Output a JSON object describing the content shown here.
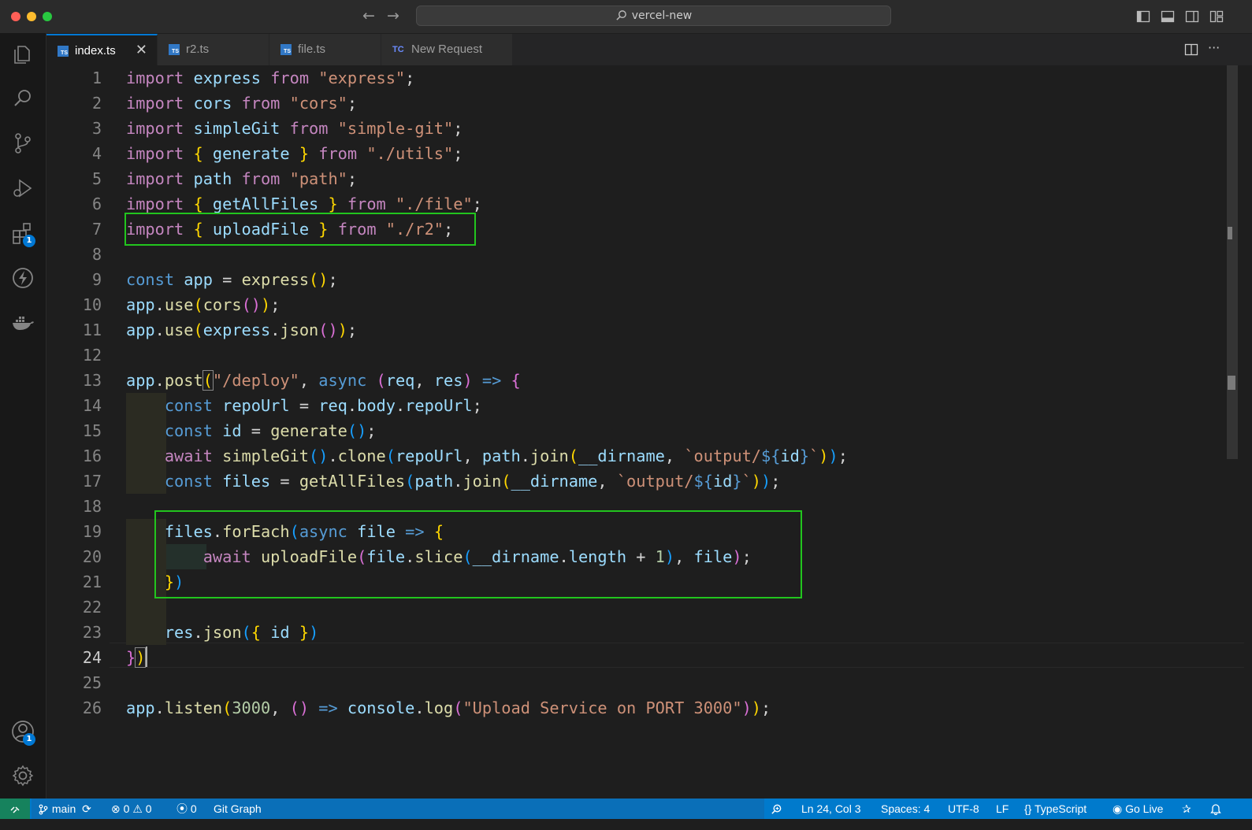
{
  "window": {
    "search_text": "vercel-new"
  },
  "tabs": [
    {
      "label": "index.ts",
      "icon": "ts-file-icon",
      "active": true
    },
    {
      "label": "r2.ts",
      "icon": "ts-file-icon"
    },
    {
      "label": "file.ts",
      "icon": "ts-file-icon"
    },
    {
      "label": "New Request",
      "icon": "tc",
      "icon_text": "TC"
    }
  ],
  "activity_bar": {
    "items": [
      "explorer-icon",
      "search-icon",
      "source-control-icon",
      "run-debug-icon",
      "extensions-icon",
      "thunder-client-icon",
      "docker-icon"
    ],
    "extensions_badge": "1",
    "accounts_badge": "1",
    "bottom_items": [
      "accounts-icon",
      "settings-gear-icon"
    ]
  },
  "editor": {
    "line_numbers": [
      "1",
      "2",
      "3",
      "4",
      "5",
      "6",
      "7",
      "8",
      "9",
      "10",
      "11",
      "12",
      "13",
      "14",
      "15",
      "16",
      "17",
      "18",
      "19",
      "20",
      "21",
      "22",
      "23",
      "24",
      "25",
      "26"
    ],
    "current_line": "24",
    "lines": [
      "import express from \"express\";",
      "import cors from \"cors\";",
      "import simpleGit from \"simple-git\";",
      "import { generate } from \"./utils\";",
      "import path from \"path\";",
      "import { getAllFiles } from \"./file\";",
      "import { uploadFile } from \"./r2\";",
      "",
      "const app = express();",
      "app.use(cors());",
      "app.use(express.json());",
      "",
      "app.post(\"/deploy\", async (req, res) => {",
      "    const repoUrl = req.body.repoUrl;",
      "    const id = generate();",
      "    await simpleGit().clone(repoUrl, path.join(__dirname, `output/${id}`));",
      "    const files = getAllFiles(path.join(__dirname, `output/${id}`));",
      "",
      "    files.forEach(async file => {",
      "        await uploadFile(file.slice(__dirname.length + 1), file);",
      "    })",
      "",
      "    res.json({ id })",
      "})",
      "",
      "app.listen(3000, () => console.log(\"Upload Service on PORT 3000\"));"
    ]
  },
  "status_bar": {
    "branch": "main",
    "errors": "0",
    "warnings": "0",
    "ports": "0",
    "git_graph": "Git Graph",
    "position": "Ln 24, Col 3",
    "spaces": "Spaces: 4",
    "encoding": "UTF-8",
    "eol": "LF",
    "language": "TypeScript",
    "go_live": "Go Live"
  },
  "colors": {
    "accent": "#007acc",
    "highlight_box": "#22c51e",
    "keyword": "#c586c0",
    "storage": "#569cd6",
    "variable": "#9cdcfe",
    "function": "#dcdcaa",
    "string": "#ce9178"
  }
}
